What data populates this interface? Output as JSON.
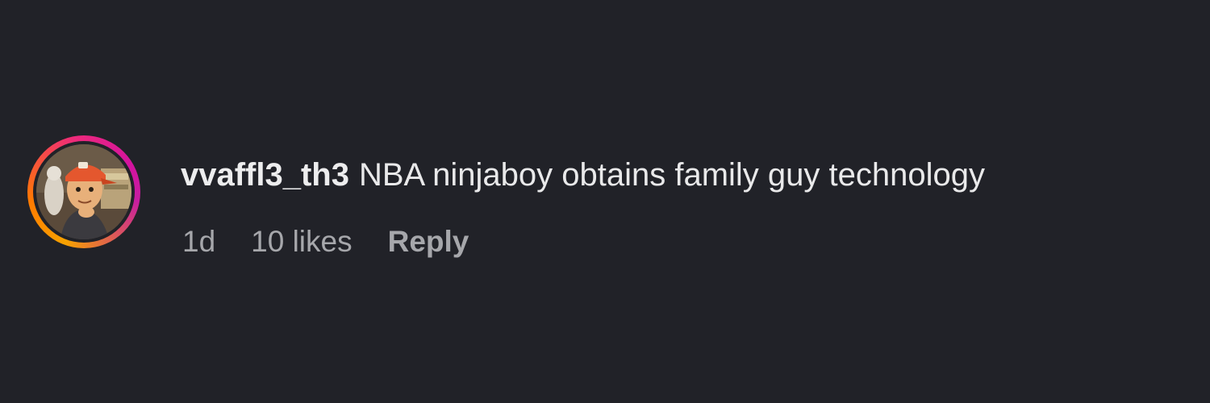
{
  "comment": {
    "username": "vvaffl3_th3",
    "text": "NBA ninjaboy obtains family guy technology",
    "time": "1d",
    "likes": "10 likes",
    "reply_label": "Reply",
    "avatar_icon": "profile-avatar"
  },
  "colors": {
    "background": "#212228",
    "text": "#e9e9ea",
    "meta": "#a6a7ab",
    "story_ring_start": "#f7a200",
    "story_ring_end": "#d3139f"
  }
}
